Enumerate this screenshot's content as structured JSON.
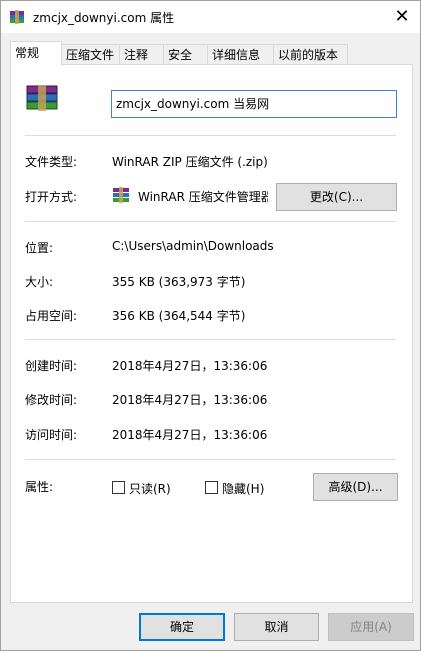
{
  "window": {
    "title": "zmcjx_downyi.com 属性",
    "close_glyph": "✕"
  },
  "tabs": [
    {
      "label": "常规"
    },
    {
      "label": "压缩文件"
    },
    {
      "label": "注释"
    },
    {
      "label": "安全"
    },
    {
      "label": "详细信息"
    },
    {
      "label": "以前的版本"
    }
  ],
  "general": {
    "file_name": "zmcjx_downyi.com  当易网",
    "type_label": "文件类型:",
    "type_value": "WinRAR ZIP 压缩文件 (.zip)",
    "open_label": "打开方式:",
    "open_value": "WinRAR 压缩文件管理器",
    "change_button": "更改(C)...",
    "location_label": "位置:",
    "location_value": "C:\\Users\\admin\\Downloads",
    "size_label": "大小:",
    "size_value": "355 KB (363,973 字节)",
    "disk_label": "占用空间:",
    "disk_value": "356 KB (364,544 字节)",
    "created_label": "创建时间:",
    "created_value": "2018年4月27日，13:36:06",
    "modified_label": "修改时间:",
    "modified_value": "2018年4月27日，13:36:06",
    "accessed_label": "访问时间:",
    "accessed_value": "2018年4月27日，13:36:06",
    "attributes_label": "属性:",
    "readonly_label": "只读(R)",
    "hidden_label": "隐藏(H)",
    "advanced_button": "高级(D)..."
  },
  "footer": {
    "ok": "确定",
    "cancel": "取消",
    "apply": "应用(A)"
  },
  "colors": {
    "focus_border": "#0078d7",
    "input_border": "#3b86d4"
  }
}
